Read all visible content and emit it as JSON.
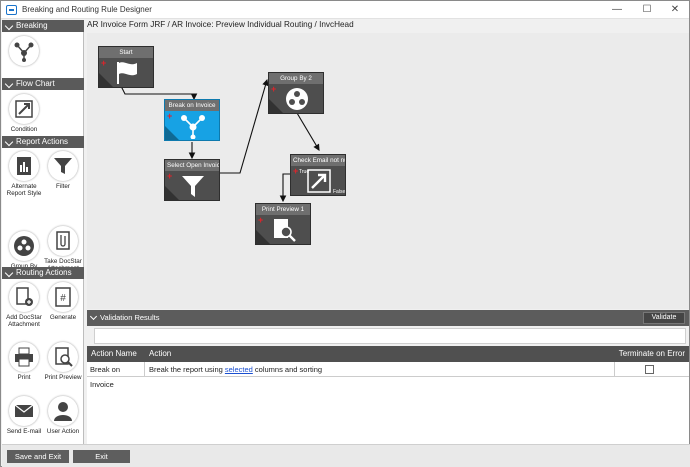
{
  "window": {
    "title": "Breaking and Routing Rule Designer",
    "minimize": "—",
    "maximize": "☐",
    "close": "✕"
  },
  "breadcrumb": "AR Invoice Form JRF  / AR Invoice: Preview Individual Routing / InvcHead",
  "sections": {
    "breaking": "Breaking",
    "flow_chart": "Flow Chart",
    "report_actions": "Report Actions",
    "routing_actions": "Routing Actions"
  },
  "tools": {
    "condition": "Condition",
    "alternate_style": "Alternate Report Style",
    "filter": "Filter",
    "group_by": "Group By",
    "take_attachment": "Take DocStar Attachment",
    "add_attachment": "Add DocStar Attachment",
    "generate": "Generate",
    "print": "Print",
    "print_preview": "Print Preview",
    "send_email": "Send E-mail",
    "user_action": "User Action"
  },
  "nodes": {
    "start": "Start",
    "break_on_invoice": "Break on Invoice",
    "select_open_invoice": "Select Open Invoic",
    "group_by_2": "Group By 2",
    "check_email": "Check Email not nu",
    "true_label": "True",
    "false_label": "False",
    "print_preview_1": "Print Preview 1"
  },
  "validation": {
    "title": "Validation Results",
    "validate_button": "Validate",
    "input_value": ""
  },
  "table": {
    "headers": {
      "action_name": "Action Name",
      "action": "Action",
      "terminate": "Terminate on Error"
    },
    "row": {
      "action_name": "Break on Invoice",
      "action_pre": "Break the report using ",
      "action_link": "selected",
      "action_post": " columns and sorting",
      "terminate_checked": false
    }
  },
  "footer": {
    "save_exit": "Save and Exit",
    "exit": "Exit"
  },
  "colors": {
    "selected_node": "#17a2e4",
    "node": "#4e4e4e",
    "header": "#505050",
    "accent": "#1a73c9"
  }
}
